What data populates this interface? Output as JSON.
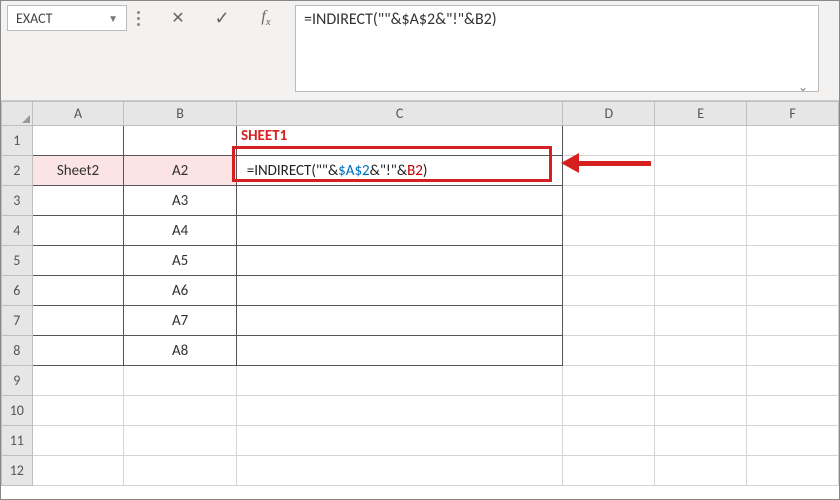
{
  "nameBox": {
    "value": "EXACT"
  },
  "formulaBar": {
    "cancel_glyph": "✕",
    "accept_glyph": "✓",
    "fx_label_f": "f",
    "fx_label_x": "x",
    "text": "=INDIRECT(\"\"&$A$2&\"!\"&B2)"
  },
  "columns": [
    "A",
    "B",
    "C",
    "D",
    "E",
    "F"
  ],
  "rows": [
    "1",
    "2",
    "3",
    "4",
    "5",
    "6",
    "7",
    "8",
    "9",
    "10",
    "11",
    "12"
  ],
  "cells": {
    "A2": "Sheet2",
    "B2": "A2",
    "B3": "A3",
    "B4": "A4",
    "B5": "A5",
    "B6": "A6",
    "B7": "A7",
    "B8": "A8"
  },
  "activeFormula": {
    "p1": "=INDIRECT(",
    "p2": "\"\"",
    "p3": "&",
    "p4": "$A$2",
    "p5": "&",
    "p6": "\"!\"",
    "p7": "&",
    "p8": "B2",
    "p9": ")"
  },
  "annotation": {
    "label": "SHEET1"
  }
}
